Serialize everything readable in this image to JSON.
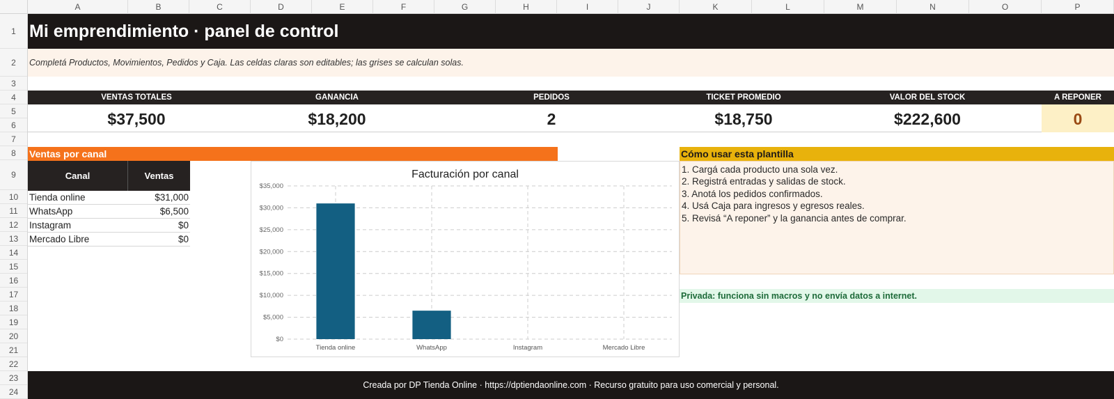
{
  "columns": [
    "A",
    "B",
    "C",
    "D",
    "E",
    "F",
    "G",
    "H",
    "I",
    "J",
    "K",
    "L",
    "M",
    "N",
    "O",
    "P"
  ],
  "rows": [
    "1",
    "2",
    "3",
    "4",
    "5",
    "6",
    "7",
    "8",
    "9",
    "10",
    "11",
    "12",
    "13",
    "14",
    "15",
    "16",
    "17",
    "18",
    "19",
    "20",
    "21",
    "22",
    "23",
    "24"
  ],
  "title": "Mi emprendimiento · panel de control",
  "subtitle": "Completá Productos, Movimientos, Pedidos y Caja. Las celdas claras son editables; las grises se calculan solas.",
  "kpis": [
    {
      "label": "VENTAS TOTALES",
      "value": "$37,500"
    },
    {
      "label": "GANANCIA",
      "value": "$18,200"
    },
    {
      "label": "PEDIDOS",
      "value": "2"
    },
    {
      "label": "TICKET PROMEDIO",
      "value": "$18,750"
    },
    {
      "label": "VALOR DEL STOCK",
      "value": "$222,600"
    },
    {
      "label": "A REPONER",
      "value": "0"
    }
  ],
  "colors": {
    "dark": "#1b1716",
    "orange": "#f5721b",
    "gold": "#e8b20c",
    "bar": "#135f82",
    "reponer_value": "#9a4a14"
  },
  "ventas": {
    "title": "Ventas por canal",
    "header_canal": "Canal",
    "header_ventas": "Ventas",
    "rows": [
      {
        "canal": "Tienda online",
        "ventas": "$31,000"
      },
      {
        "canal": "WhatsApp",
        "ventas": "$6,500"
      },
      {
        "canal": "Instagram",
        "ventas": "$0"
      },
      {
        "canal": "Mercado Libre",
        "ventas": "$0"
      }
    ]
  },
  "chart_data": {
    "type": "bar",
    "title": "Facturación por canal",
    "categories": [
      "Tienda online",
      "WhatsApp",
      "Instagram",
      "Mercado Libre"
    ],
    "values": [
      31000,
      6500,
      0,
      0
    ],
    "ylim": [
      0,
      35000
    ],
    "yticks": [
      "$0",
      "$5,000",
      "$10,000",
      "$15,000",
      "$20,000",
      "$25,000",
      "$30,000",
      "$35,000"
    ],
    "grid": true,
    "color": "#135f82"
  },
  "como_usar": {
    "title": "Cómo usar esta plantilla",
    "steps": [
      "1. Cargá cada producto una sola vez.",
      "2. Registrá entradas y salidas de stock.",
      "3. Anotá los pedidos confirmados.",
      "4. Usá Caja para ingresos y egresos reales.",
      "5. Revisá “A reponer” y la ganancia antes de comprar."
    ]
  },
  "privada": "Privada: funciona sin macros y no envía datos a internet.",
  "footer": "Creada por DP Tienda Online · https://dptiendaonline.com · Recurso gratuito para uso comercial y personal."
}
